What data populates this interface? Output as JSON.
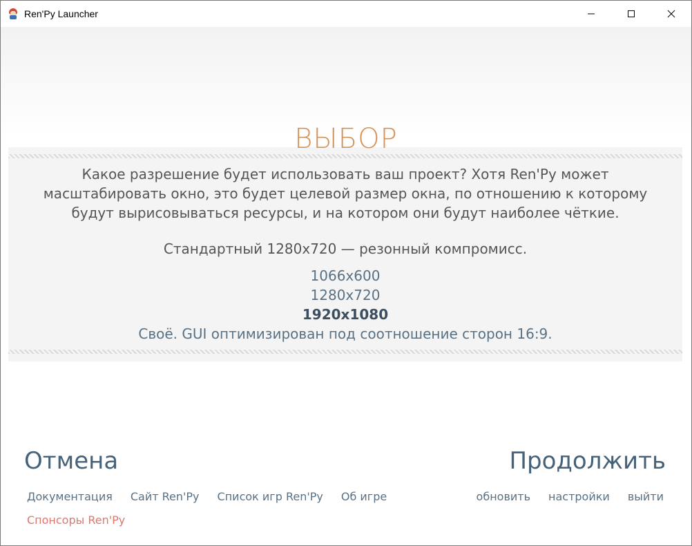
{
  "window": {
    "title": "Ren'Py Launcher"
  },
  "header": {
    "title": "ВЫБОР"
  },
  "panel": {
    "description_lines": [
      "Какое разрешение будет использовать ваш проект? Хотя Ren'Py может",
      "масштабировать окно, это будет целевой размер окна, по отношению к которому",
      "будут вырисовываться ресурсы, и на котором они будут наиболее чёткие."
    ],
    "hint": "Стандартный 1280x720 — резонный компромисс.",
    "choices": [
      {
        "label": "1066x600",
        "selected": false
      },
      {
        "label": "1280x720",
        "selected": false
      },
      {
        "label": "1920x1080",
        "selected": true
      },
      {
        "label": "Своё. GUI оптимизирован под соотношение сторон 16:9.",
        "selected": false
      }
    ]
  },
  "actions": {
    "cancel": "Отмена",
    "continue": "Продолжить"
  },
  "footer": {
    "left_links": [
      "Документация",
      "Сайт Ren'Py",
      "Список игр Ren'Py",
      "Об игре"
    ],
    "right_links": [
      "обновить",
      "настройки",
      "выйти"
    ],
    "sponsors": "Спонсоры Ren'Py"
  },
  "colors": {
    "accent": "#d4935a",
    "link": "#587184",
    "heading": "#46627a",
    "sponsor": "#e2766a",
    "text": "#555555"
  }
}
